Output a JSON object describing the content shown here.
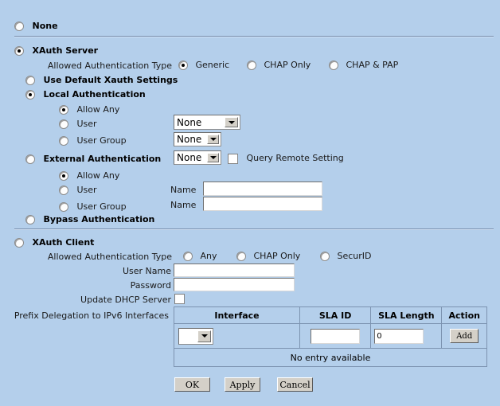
{
  "colors": {
    "background": "#b4cfeb",
    "divider": "#7a90ad",
    "table_border": "#7c93b0",
    "button_face": "#d4d0c8",
    "input_bg": "#ffffff"
  },
  "none_option": {
    "label": "None",
    "selected": false
  },
  "xauth_server": {
    "label": "XAuth Server",
    "selected": true,
    "allowed_auth_type": {
      "label": "Allowed Authentication Type",
      "options": [
        {
          "label": "Generic",
          "selected": true
        },
        {
          "label": "CHAP Only",
          "selected": false
        },
        {
          "label": "CHAP & PAP",
          "selected": false
        }
      ]
    },
    "use_default_xauth_settings": {
      "label": "Use Default Xauth Settings",
      "selected": false
    },
    "local_authentication": {
      "label": "Local Authentication",
      "selected": true,
      "allow_any": {
        "label": "Allow Any",
        "selected": true
      },
      "user": {
        "label": "User",
        "selected": false,
        "dropdown_value": "None"
      },
      "user_group": {
        "label": "User Group",
        "selected": false,
        "dropdown_value": "None"
      }
    },
    "external_authentication": {
      "label": "External Authentication",
      "selected": false,
      "dropdown_value": "None",
      "query_remote_setting": {
        "label": "Query Remote Setting",
        "checked": false
      },
      "allow_any": {
        "label": "Allow Any",
        "selected": true
      },
      "user": {
        "label": "User",
        "selected": false,
        "name_label": "Name",
        "name_value": ""
      },
      "user_group": {
        "label": "User Group",
        "selected": false,
        "name_label": "Name",
        "name_value": ""
      }
    },
    "bypass_authentication": {
      "label": "Bypass Authentication",
      "selected": false
    }
  },
  "xauth_client": {
    "label": "XAuth Client",
    "selected": false,
    "allowed_auth_type": {
      "label": "Allowed Authentication Type",
      "options": [
        {
          "label": "Any",
          "selected": false
        },
        {
          "label": "CHAP Only",
          "selected": false
        },
        {
          "label": "SecurID",
          "selected": false
        }
      ]
    },
    "user_name": {
      "label": "User Name",
      "value": ""
    },
    "password": {
      "label": "Password",
      "value": ""
    },
    "update_dhcp_server": {
      "label": "Update DHCP Server",
      "checked": false
    }
  },
  "prefix_delegation": {
    "label": "Prefix Delegation to IPv6 Interfaces",
    "headers": [
      "Interface",
      "SLA ID",
      "SLA Length",
      "Action"
    ],
    "entry_row": {
      "interface_value": "",
      "sla_id_value": "",
      "sla_length_value": "0",
      "action_label": "Add"
    },
    "empty_message": "No entry available"
  },
  "footer": {
    "ok_label": "OK",
    "apply_label": "Apply",
    "cancel_label": "Cancel"
  }
}
